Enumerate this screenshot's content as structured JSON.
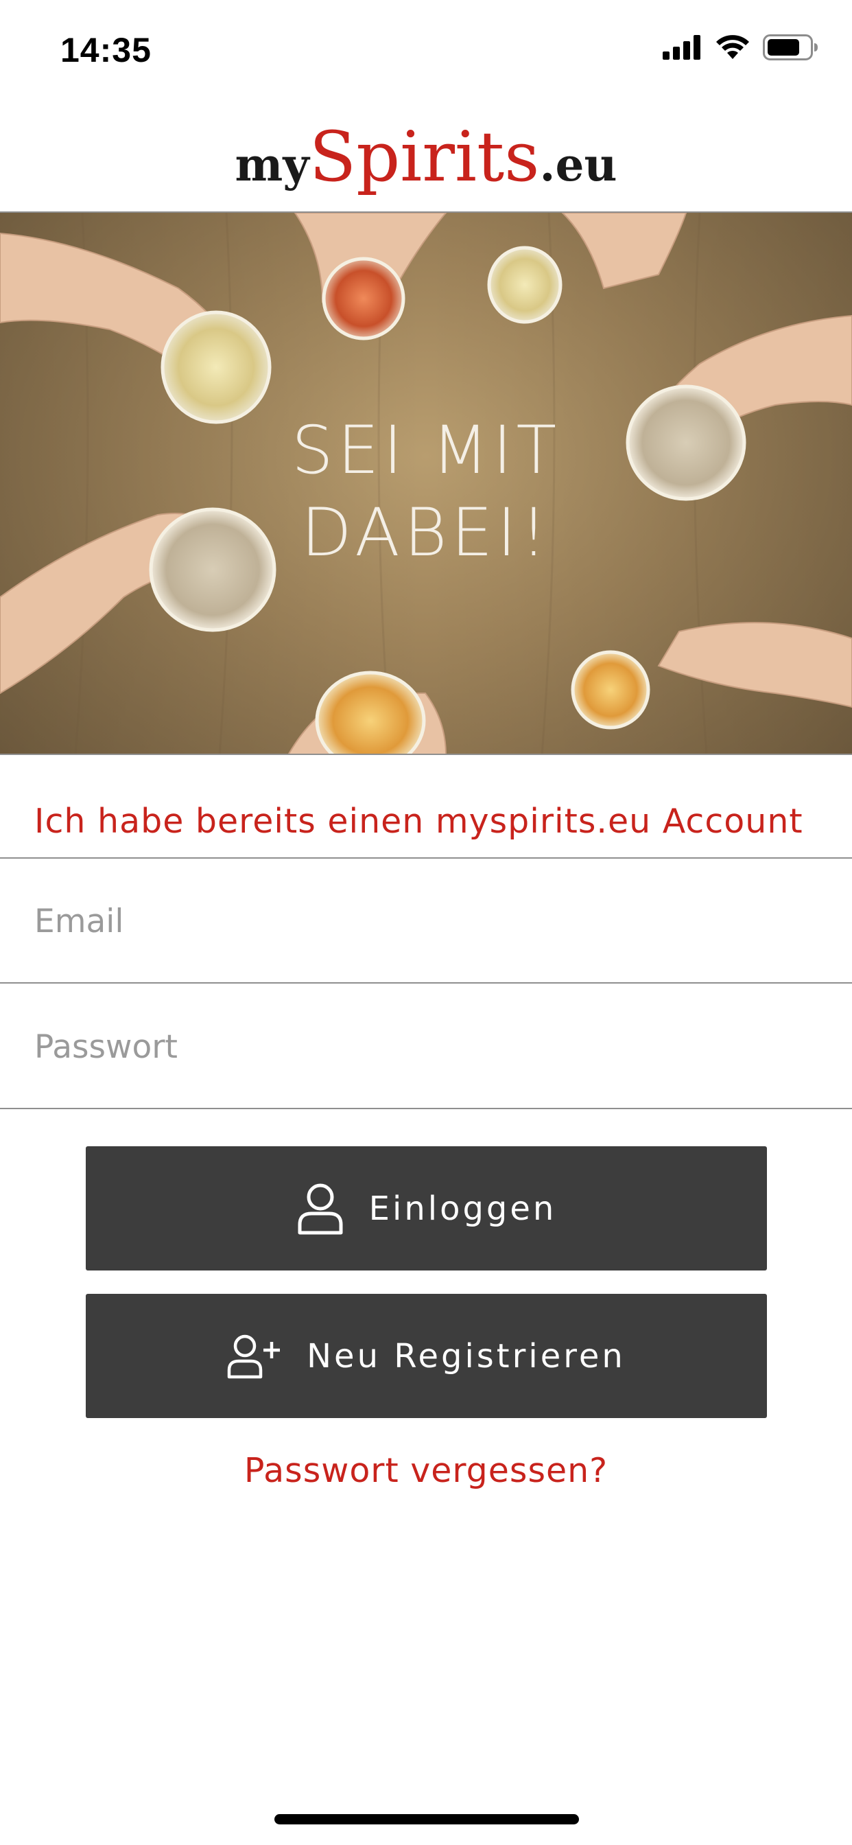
{
  "status_bar": {
    "time": "14:35",
    "icons": [
      "cellular-signal-icon",
      "wifi-icon",
      "battery-icon"
    ]
  },
  "header": {
    "logo": {
      "part_my": "my",
      "part_spirits": "Spirits",
      "part_eu": ".eu"
    },
    "colors": {
      "brand_red": "#c8231c",
      "dark": "#1a1a1a"
    }
  },
  "hero": {
    "line1": "SEI MIT",
    "line2": "DABEI!"
  },
  "login_form": {
    "heading": "Ich habe bereits einen myspirits.eu Account",
    "email_placeholder": "Email",
    "password_placeholder": "Passwort",
    "login_button_label": "Einloggen",
    "login_button_icon": "user-icon",
    "register_button_label": "Neu Registrieren",
    "register_button_icon": "user-plus-icon",
    "forgot_password_link": "Passwort vergessen?",
    "colors": {
      "button_bg": "#3d3d3d",
      "link": "#c8231c"
    }
  }
}
